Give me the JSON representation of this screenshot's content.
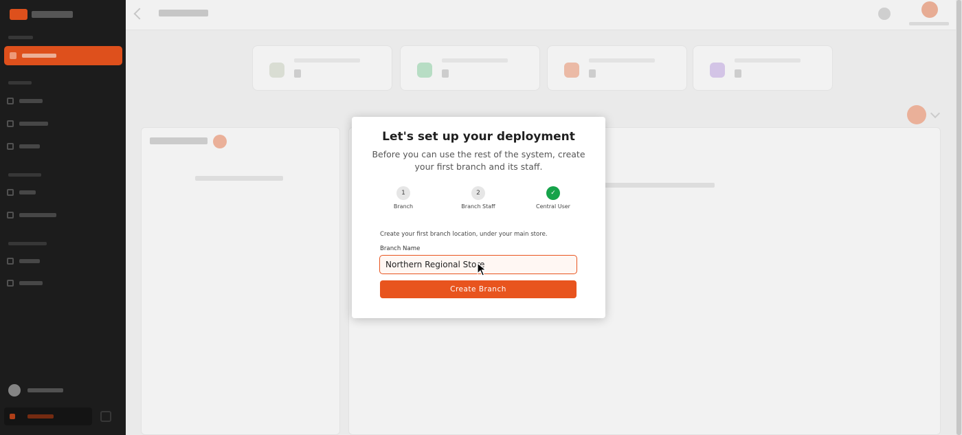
{
  "modal": {
    "title": "Let's set up your deployment",
    "subtitle": "Before you can use the rest of the system, create your first branch and its staff.",
    "steps": [
      {
        "number": "1",
        "label": "Branch",
        "status": "current"
      },
      {
        "number": "2",
        "label": "Branch Staff",
        "status": "pending"
      },
      {
        "number": "✓",
        "label": "Central User",
        "status": "done"
      }
    ],
    "instruction": "Create your first branch location, under your main store.",
    "field": {
      "label": "Branch Name",
      "value": "Northern Regional Store",
      "placeholder": ""
    },
    "submit_label": "Create Branch"
  },
  "colors": {
    "accent": "#e8541e",
    "success": "#16a34a",
    "sidebar": "#1e1e1e"
  },
  "icons": {
    "step_done": "check-icon",
    "cursor": "mouse-pointer-icon"
  }
}
